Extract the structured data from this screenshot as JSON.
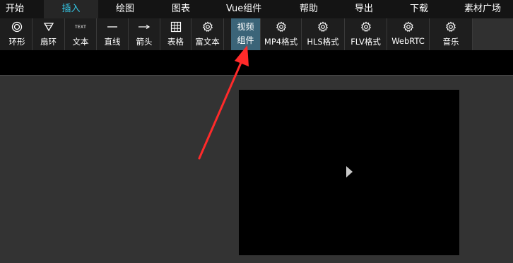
{
  "menu": {
    "items": [
      {
        "label": "开始"
      },
      {
        "label": "插入"
      },
      {
        "label": "绘图"
      },
      {
        "label": "图表"
      },
      {
        "label": "Vue组件"
      },
      {
        "label": "帮助"
      },
      {
        "label": "导出"
      },
      {
        "label": "下载"
      },
      {
        "label": "素材广场"
      }
    ],
    "active": "插入",
    "active_color": "#35c7e6"
  },
  "ribbon": {
    "tools": [
      {
        "label": "环形",
        "icon": "ring-icon"
      },
      {
        "label": "扇环",
        "icon": "sector-ring-icon"
      },
      {
        "label": "文本",
        "icon": "text-icon",
        "icon_text": "TEXT"
      },
      {
        "label": "直线",
        "icon": "line-icon"
      },
      {
        "label": "箭头",
        "icon": "arrow-icon"
      },
      {
        "label": "表格",
        "icon": "table-icon"
      },
      {
        "label": "富文本",
        "icon": "gear-icon"
      },
      {
        "label_line1": "视频",
        "label_line2": "组件",
        "highlighted": true
      },
      {
        "label": "MP4格式",
        "icon": "gear-icon"
      },
      {
        "label": "HLS格式",
        "icon": "gear-icon"
      },
      {
        "label": "FLV格式",
        "icon": "gear-icon"
      },
      {
        "label": "WebRTC",
        "icon": "gear-icon"
      },
      {
        "label": "音乐",
        "icon": "gear-icon"
      }
    ],
    "highlight_color": "#3b6478"
  },
  "annotation": {
    "color": "#ff2a2a"
  },
  "video": {
    "play_icon": "play-icon"
  }
}
